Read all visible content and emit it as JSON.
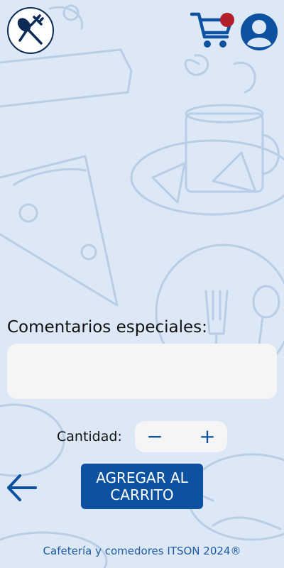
{
  "header": {
    "logo_icon": "fork-spoon-icon",
    "cart_icon": "shopping-cart-icon",
    "profile_icon": "user-account-icon",
    "cart_has_items": true
  },
  "comments": {
    "label": "Comentarios especiales:",
    "value": "",
    "placeholder": ""
  },
  "quantity": {
    "label": "Cantidad:",
    "value": "",
    "decrement_symbol": "−",
    "increment_symbol": "+"
  },
  "actions": {
    "back_icon": "arrow-left-icon",
    "add_to_cart_label": "AGREGAR AL CARRITO"
  },
  "footer": {
    "text": "Cafetería y comedores ITSON 2024®"
  },
  "colors": {
    "background": "#dce8f5",
    "primary": "#0d52a0",
    "badge": "#b3202b",
    "footer_text": "#1f5aa3"
  }
}
